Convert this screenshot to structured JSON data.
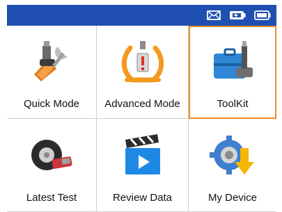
{
  "status_bar": {
    "color": "#1f4fb0",
    "icons": [
      "mail-icon",
      "battery-charging-icon",
      "battery-icon"
    ]
  },
  "menu": {
    "selected_index": 2,
    "accent_color": "#f08a24",
    "items": [
      {
        "label": "Quick Mode",
        "icon": "tire-valve-wrench-icon"
      },
      {
        "label": "Advanced Mode",
        "icon": "tpms-warning-icon"
      },
      {
        "label": "ToolKit",
        "icon": "toolbox-sensor-icon"
      },
      {
        "label": "Latest Test",
        "icon": "tire-scan-icon"
      },
      {
        "label": "Review Data",
        "icon": "video-clapper-icon"
      },
      {
        "label": "My Device",
        "icon": "settings-download-icon"
      }
    ]
  }
}
